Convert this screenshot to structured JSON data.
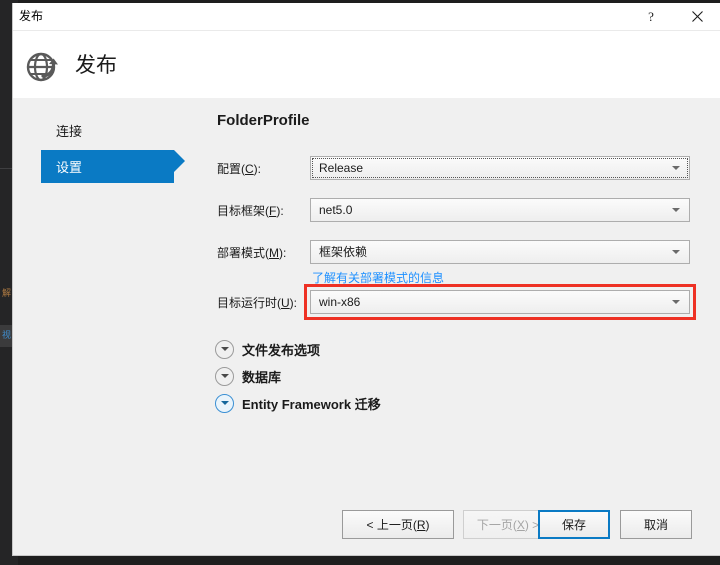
{
  "window": {
    "titlebar_text": "发布",
    "help_label": "?",
    "close_label": "✕"
  },
  "header": {
    "icon": "publish-globe-icon",
    "title": "发布"
  },
  "sidebar": {
    "items": [
      {
        "label": "连接",
        "selected": false
      },
      {
        "label": "设置",
        "selected": true
      }
    ]
  },
  "main": {
    "profile_title": "FolderProfile",
    "fields": [
      {
        "label_prefix": "配置(",
        "accel": "C",
        "label_suffix": "):",
        "value": "Release",
        "focused": true,
        "highlighted": false
      },
      {
        "label_prefix": "目标框架(",
        "accel": "F",
        "label_suffix": "):",
        "value": "net5.0",
        "focused": false,
        "highlighted": false
      },
      {
        "label_prefix": "部署模式(",
        "accel": "M",
        "label_suffix": "):",
        "value": "框架依赖",
        "focused": false,
        "highlighted": false
      },
      {
        "label_prefix": "目标运行时(",
        "accel": "U",
        "label_suffix": "):",
        "value": "win-x86",
        "focused": false,
        "highlighted": true
      }
    ],
    "deployment_link": "了解有关部署模式的信息",
    "sections": [
      {
        "label": "文件发布选项",
        "active": false
      },
      {
        "label": "数据库",
        "active": false
      },
      {
        "label": "Entity Framework 迁移",
        "active": true
      }
    ]
  },
  "footer": {
    "buttons": [
      {
        "prefix": "< 上一页(",
        "accel": "R",
        "suffix": ")",
        "state": "normal",
        "name": "previous-button"
      },
      {
        "prefix": "下一页(",
        "accel": "X",
        "suffix": ") >",
        "state": "disabled",
        "name": "next-button"
      },
      {
        "prefix": "保存",
        "accel": "",
        "suffix": "",
        "state": "default",
        "name": "save-button"
      },
      {
        "prefix": "取消",
        "accel": "",
        "suffix": "",
        "state": "normal",
        "name": "cancel-button"
      }
    ]
  },
  "colors": {
    "accent": "#0a7ac4",
    "link": "#1e90ff",
    "annotation": "#ee3124",
    "dialog_bg": "#f0f0f0",
    "header_bg": "#ffffff",
    "backdrop": "#1e1e1e"
  },
  "backdrop": {
    "ghost_labels": [
      "解",
      "视"
    ]
  }
}
